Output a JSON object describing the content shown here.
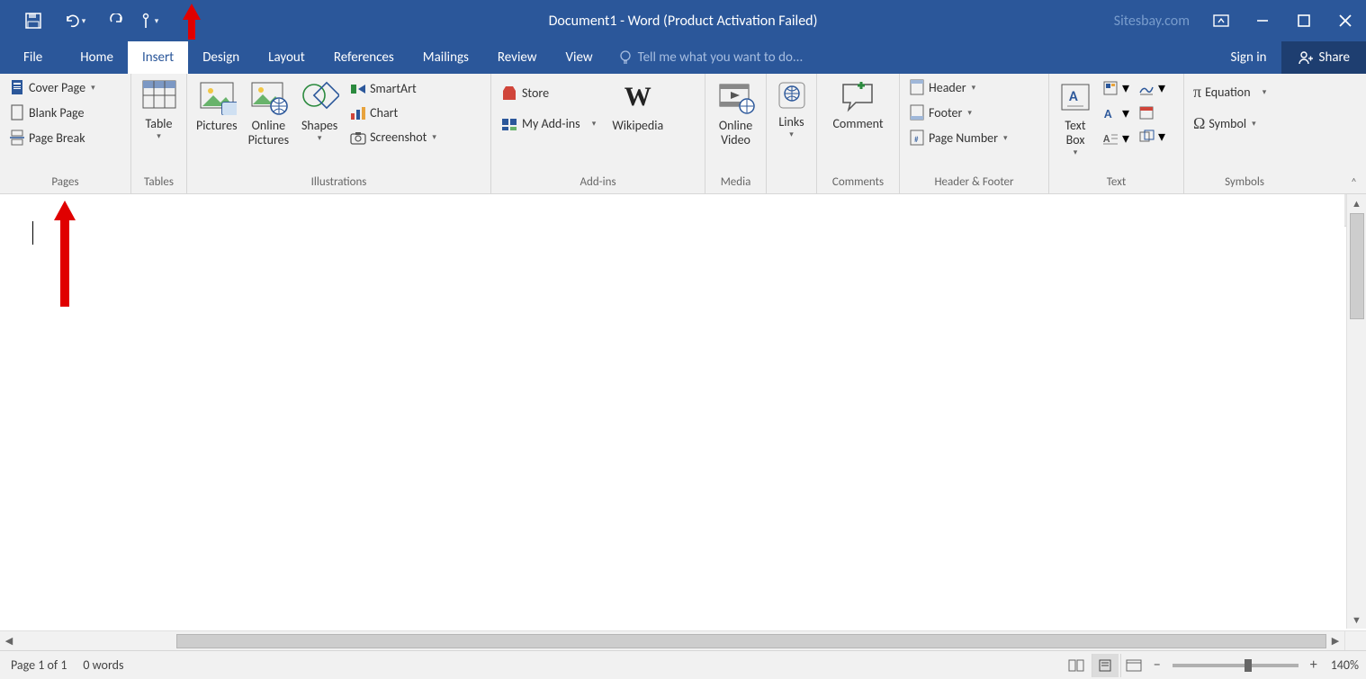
{
  "title": "Document1 - Word (Product Activation Failed)",
  "watermark": "Sitesbay.com",
  "tabs": {
    "file": "File",
    "home": "Home",
    "insert": "Insert",
    "design": "Design",
    "layout": "Layout",
    "references": "References",
    "mailings": "Mailings",
    "review": "Review",
    "view": "View",
    "tellme": "Tell me what you want to do...",
    "signin": "Sign in",
    "share": "Share"
  },
  "ribbon": {
    "pages": {
      "label": "Pages",
      "cover": "Cover Page",
      "blank": "Blank Page",
      "break": "Page Break"
    },
    "tables": {
      "label": "Tables",
      "table": "Table"
    },
    "illustrations": {
      "label": "Illustrations",
      "pictures": "Pictures",
      "online_pictures": "Online\nPictures",
      "shapes": "Shapes",
      "smartart": "SmartArt",
      "chart": "Chart",
      "screenshot": "Screenshot"
    },
    "addins": {
      "label": "Add-ins",
      "store": "Store",
      "my": "My Add-ins",
      "wikipedia": "Wikipedia"
    },
    "media": {
      "label": "Media",
      "online_video": "Online\nVideo"
    },
    "links": {
      "label": "",
      "links": "Links"
    },
    "comments": {
      "label": "Comments",
      "comment": "Comment"
    },
    "headerfooter": {
      "label": "Header & Footer",
      "header": "Header",
      "footer": "Footer",
      "page_number": "Page Number"
    },
    "text": {
      "label": "Text",
      "textbox": "Text\nBox"
    },
    "symbols": {
      "label": "Symbols",
      "equation": "Equation",
      "symbol": "Symbol"
    }
  },
  "status": {
    "page": "Page 1 of 1",
    "words": "0 words",
    "zoom": "140%"
  }
}
